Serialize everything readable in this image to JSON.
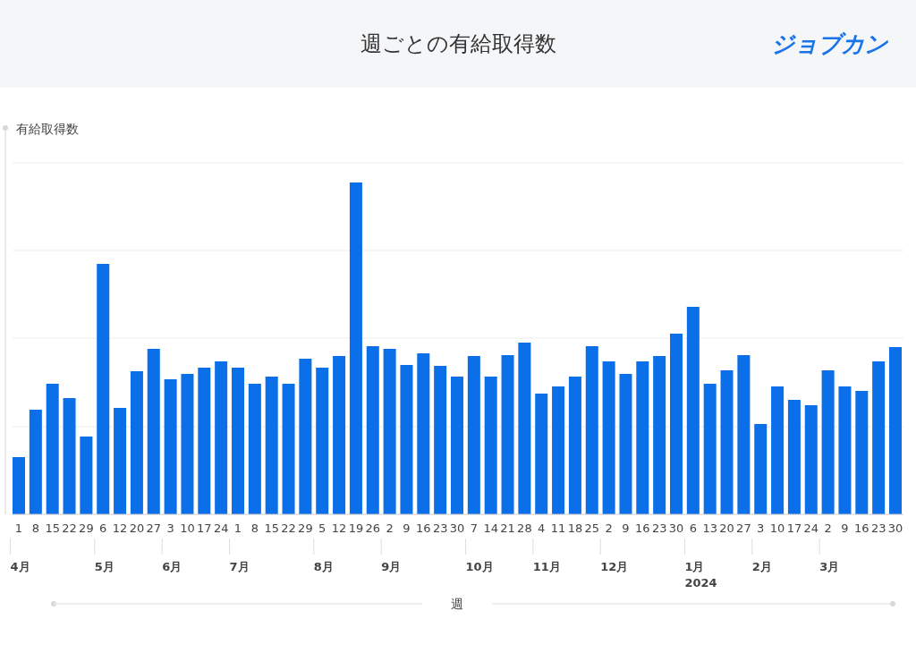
{
  "header": {
    "title": "週ごとの有給取得数",
    "logo": "ジョブカン"
  },
  "chart": {
    "y_axis_title": "有給取得数",
    "x_axis_title": "週",
    "weeks": [
      {
        "label": "1",
        "month": "4月"
      },
      {
        "label": "8"
      },
      {
        "label": "15"
      },
      {
        "label": "22"
      },
      {
        "label": "29"
      },
      {
        "label": "6",
        "month": "5月"
      },
      {
        "label": "12"
      },
      {
        "label": "20"
      },
      {
        "label": "27"
      },
      {
        "label": "3",
        "month": "6月"
      },
      {
        "label": "10"
      },
      {
        "label": "17"
      },
      {
        "label": "24"
      },
      {
        "label": "1",
        "month": "7月"
      },
      {
        "label": "8"
      },
      {
        "label": "15"
      },
      {
        "label": "22"
      },
      {
        "label": "29"
      },
      {
        "label": "5",
        "month": "8月"
      },
      {
        "label": "12"
      },
      {
        "label": "19"
      },
      {
        "label": "26"
      },
      {
        "label": "2",
        "month": "9月"
      },
      {
        "label": "9"
      },
      {
        "label": "16"
      },
      {
        "label": "23"
      },
      {
        "label": "30"
      },
      {
        "label": "7",
        "month": "10月"
      },
      {
        "label": "14"
      },
      {
        "label": "21"
      },
      {
        "label": "28"
      },
      {
        "label": "4",
        "month": "11月"
      },
      {
        "label": "11"
      },
      {
        "label": "18"
      },
      {
        "label": "25"
      },
      {
        "label": "2",
        "month": "12月"
      },
      {
        "label": "9"
      },
      {
        "label": "16"
      },
      {
        "label": "23"
      },
      {
        "label": "30"
      },
      {
        "label": "6",
        "month": "1月",
        "year": "2024"
      },
      {
        "label": "13"
      },
      {
        "label": "20"
      },
      {
        "label": "27"
      },
      {
        "label": "3",
        "month": "2月"
      },
      {
        "label": "10"
      },
      {
        "label": "17"
      },
      {
        "label": "24"
      },
      {
        "label": "2",
        "month": "3月"
      },
      {
        "label": "9"
      },
      {
        "label": "16"
      },
      {
        "label": "23"
      },
      {
        "label": "30"
      }
    ]
  }
}
